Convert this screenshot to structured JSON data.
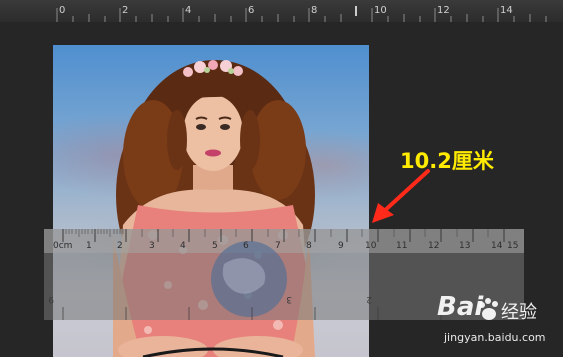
{
  "top_ruler": {
    "labels": [
      "0",
      "2",
      "4",
      "6",
      "8",
      "10",
      "12",
      "14"
    ]
  },
  "overlay_ruler": {
    "unit_label": "0cm",
    "labels": [
      "1",
      "2",
      "3",
      "4",
      "5",
      "6",
      "7",
      "8",
      "9",
      "10",
      "11",
      "12",
      "13",
      "14",
      "15"
    ]
  },
  "annotation": {
    "text": "10.2厘米",
    "color": "#ffeb00"
  },
  "watermark": {
    "logo": "Bai",
    "logo_suffix": "经验",
    "url": "jingyan.baidu.com"
  }
}
